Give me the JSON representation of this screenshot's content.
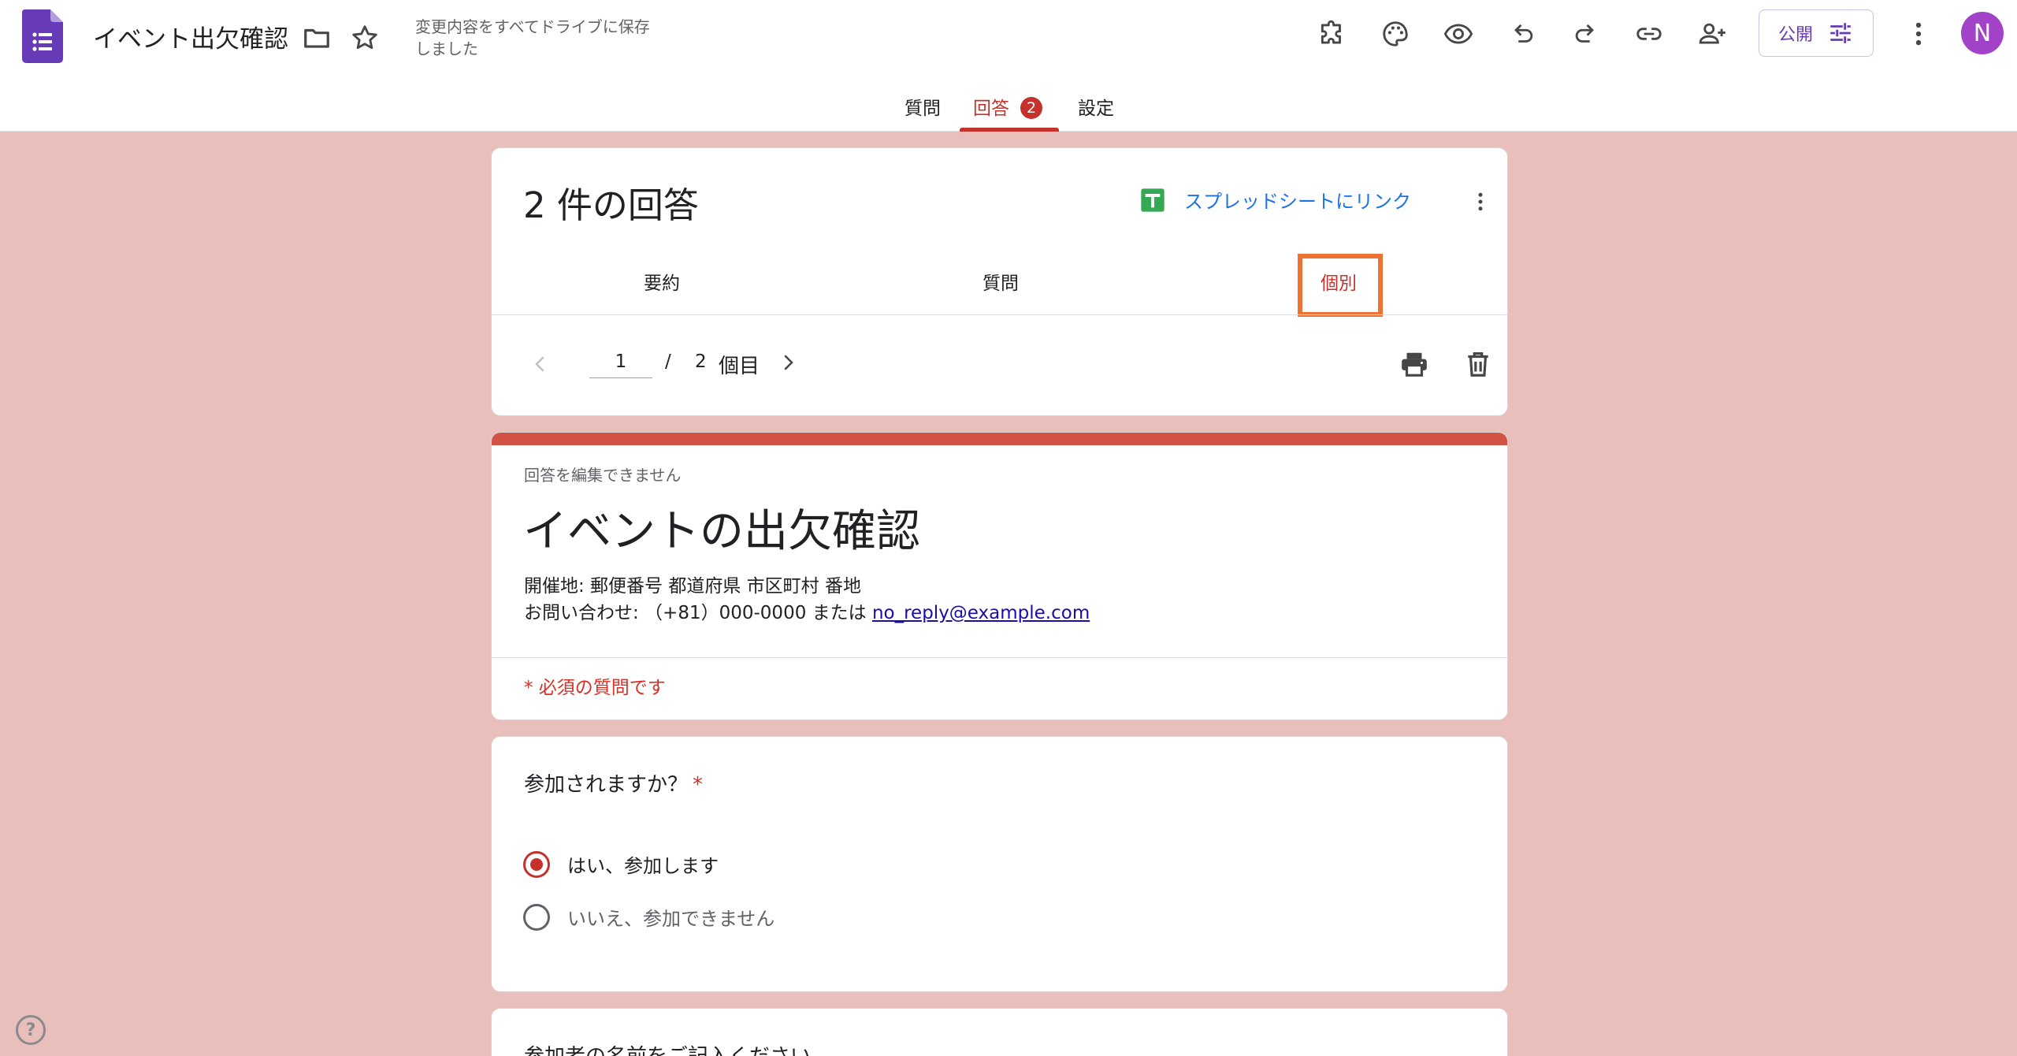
{
  "header": {
    "title": "イベント出欠確認",
    "save_status": "変更内容をすべてドライブに保存しました",
    "publish_label": "公開",
    "avatar_initial": "N",
    "tabs": [
      {
        "label": "質問"
      },
      {
        "label": "回答",
        "badge": "2"
      },
      {
        "label": "設定"
      }
    ],
    "icons": [
      "form-logo-icon",
      "folder-icon",
      "star-icon",
      "addon-icon",
      "palette-icon",
      "eye-icon",
      "undo-icon",
      "redo-icon",
      "link-icon",
      "add-person-icon",
      "tune-icon",
      "more-vert-icon"
    ]
  },
  "responses": {
    "count_label": "2 件の回答",
    "sheet_link_label": "スプレッドシートにリンク",
    "subtabs": [
      {
        "label": "要約"
      },
      {
        "label": "質問"
      },
      {
        "label": "個別"
      }
    ],
    "pager": {
      "current": "1",
      "separator": "/",
      "total": "2",
      "unit": "個目"
    }
  },
  "form": {
    "cannot_edit": "回答を編集できません",
    "title": "イベントの出欠確認",
    "desc_line1": "開催地: 郵便番号 都道府県 市区町村 番地",
    "desc_line2_prefix": "お問い合わせ: （+81）000-0000 または ",
    "desc_email": "no_reply@example.com",
    "required_note": "* 必須の質問です"
  },
  "question1": {
    "title": "参加されますか？",
    "required_mark": "*",
    "options": [
      {
        "label": "はい、参加します",
        "selected": true
      },
      {
        "label": "いいえ、参加できません",
        "selected": false
      }
    ]
  },
  "question2": {
    "title": "参加者の名前をご記入ください"
  },
  "colors": {
    "accent": "#c5322b",
    "background": "#e9bfbc",
    "highlight": "#ee7332",
    "publish": "#673ab7"
  }
}
